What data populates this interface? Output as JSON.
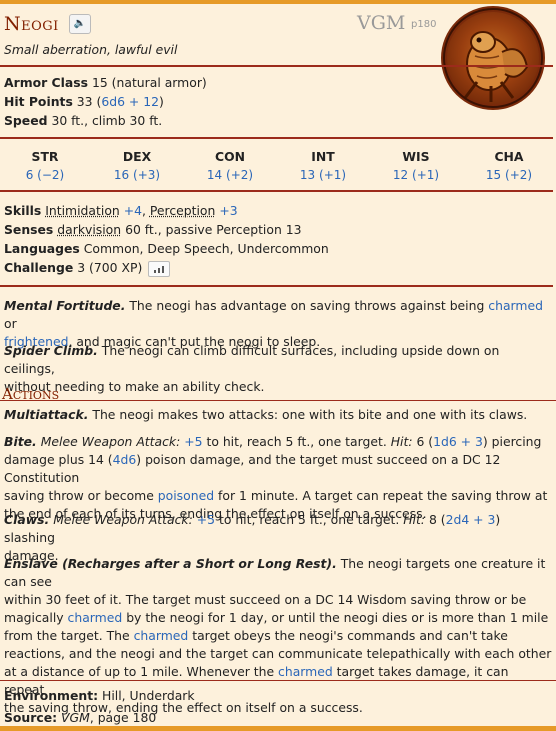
{
  "header": {
    "name": "Neogi",
    "source_book": "VGM",
    "source_page": "p180",
    "subtitle": "Small aberration, lawful evil"
  },
  "core": {
    "ac_label": "Armor Class",
    "ac_value": "15 (natural armor)",
    "hp_label": "Hit Points",
    "hp_value": "33",
    "hp_dice": "6d6 + 12",
    "speed_label": "Speed",
    "speed_value": "30 ft., climb 30 ft."
  },
  "abilities": [
    {
      "name": "STR",
      "value": "6 (−2)"
    },
    {
      "name": "DEX",
      "value": "16 (+3)"
    },
    {
      "name": "CON",
      "value": "14 (+2)"
    },
    {
      "name": "INT",
      "value": "13 (+1)"
    },
    {
      "name": "WIS",
      "value": "12 (+1)"
    },
    {
      "name": "CHA",
      "value": "15 (+2)"
    }
  ],
  "details": {
    "skills_label": "Skills",
    "skill1": "Intimidation",
    "skill1_bonus": "+4",
    "skill2": "Perception",
    "skill2_bonus": "+3",
    "senses_label": "Senses",
    "senses_link": "darkvision",
    "senses_rest": "60 ft., passive Perception 13",
    "languages_label": "Languages",
    "languages_value": "Common, Deep Speech, Undercommon",
    "challenge_label": "Challenge",
    "challenge_value": "3 (700 XP)"
  },
  "traits": {
    "mental_name": "Mental Fortitude.",
    "mental_t1": " The neogi has advantage on saving throws against being ",
    "mental_l1": "charmed",
    "mental_t2": " or",
    "mental_l2": "frightened",
    "mental_t3": ", and magic can't put the neogi to sleep.",
    "spider_name": "Spider Climb.",
    "spider_t1": " The neogi can climb difficult surfaces, including upside down on ceilings,",
    "spider_t2": "without needing to make an ability check."
  },
  "actions": {
    "header": "Actions",
    "multi_name": "Multiattack.",
    "multi_text": " The neogi makes two attacks: one with its bite and one with its claws.",
    "bite_name": "Bite.",
    "bite_type": "Melee Weapon Attack:",
    "bite_bonus": "+5",
    "bite_t1": " to hit, reach 5 ft., one target. ",
    "hit_label": "Hit:",
    "bite_t2": " 6 (",
    "bite_dice1": "1d6 + 3",
    "bite_t3": ") piercing",
    "bite_l2a": "damage plus 14 (",
    "bite_dice2": "4d6",
    "bite_l2b": ") poison damage, and the target must succeed on a DC 12 Constitution",
    "bite_l3": "saving throw or become ",
    "bite_poisoned": "poisoned",
    "bite_l3b": " for 1 minute. A target can repeat the saving throw at",
    "bite_l4": "the end of each of its turns, ending the effect on itself on a success.",
    "claws_name": "Claws.",
    "claws_type": "Melee Weapon Attack:",
    "claws_bonus": "+5",
    "claws_t1": " to hit, reach 5 ft., one target. ",
    "claws_t2": " 8 (",
    "claws_dice": "2d4 + 3",
    "claws_t3": ") slashing",
    "claws_l2": "damage.",
    "enslave_name": "Enslave (Recharges after a Short or Long Rest).",
    "enslave_l1": " The neogi targets one creature it can see",
    "enslave_l2": "within 30 feet of it. The target must succeed on a DC 14 Wisdom saving throw or be",
    "enslave_l3a": "magically ",
    "enslave_charmed1": "charmed",
    "enslave_l3b": " by the neogi for 1 day, or until the neogi dies or is more than 1 mile",
    "enslave_l4a": "from the target. The ",
    "enslave_charmed2": "charmed",
    "enslave_l4b": " target obeys the neogi's commands and can't take",
    "enslave_l5": "reactions, and the neogi and the target can communicate telepathically with each other",
    "enslave_l6a": "at a distance of up to 1 mile. Whenever the ",
    "enslave_charmed3": "charmed",
    "enslave_l6b": " target takes damage, it can repeat",
    "enslave_l7": "the saving throw, ending the effect on itself on a success."
  },
  "footer": {
    "env_label": "Environment:",
    "env_value": "Hill, Underdark",
    "src_label": "Source:",
    "src_book": "VGM",
    "src_rest": ", page 180"
  },
  "colors": {
    "accent": "#822000",
    "rule": "#9c2b1b",
    "link": "#2a66b8",
    "bar": "#e69a28",
    "background": "#fdf1dc"
  },
  "icons": [
    "speaker-icon",
    "chart-icon",
    "creature-portrait"
  ]
}
